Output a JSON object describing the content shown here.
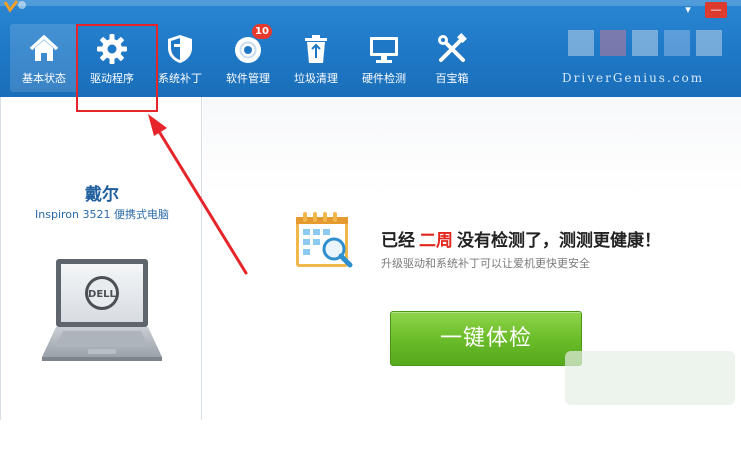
{
  "toolbar": {
    "items": [
      {
        "label": "基本状态",
        "icon": "home-icon"
      },
      {
        "label": "驱动程序",
        "icon": "gear-icon"
      },
      {
        "label": "系统补丁",
        "icon": "shield-icon"
      },
      {
        "label": "软件管理",
        "icon": "disc-icon",
        "badge": "10"
      },
      {
        "label": "垃圾清理",
        "icon": "recycle-bin-icon"
      },
      {
        "label": "硬件检测",
        "icon": "monitor-icon"
      },
      {
        "label": "百宝箱",
        "icon": "tools-icon"
      }
    ]
  },
  "window_controls": {
    "minimize": "▾",
    "close": "—"
  },
  "brand": {
    "site": "DriverGenius.com"
  },
  "device": {
    "brand": "戴尔",
    "model": "Inspiron 3521 便携式电脑"
  },
  "status": {
    "headline_prefix": "已经",
    "headline_highlight": "二周",
    "headline_suffix": "没有检测了，测测更健康！",
    "subline": "升级驱动和系统补丁可以让爱机更快更安全"
  },
  "actions": {
    "check_button": "一键体检"
  },
  "colors": {
    "toolbar_blue": "#1f78c6",
    "accent_red": "#e0261e",
    "button_green": "#6cbd2a",
    "annotation_red": "#e6252a"
  }
}
